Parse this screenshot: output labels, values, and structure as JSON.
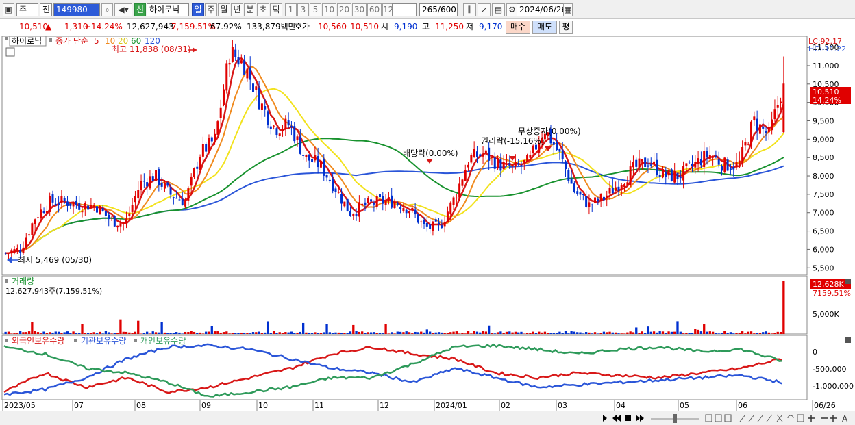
{
  "toolbar": {
    "period_main": "주",
    "prev_label": "전",
    "code": "149980",
    "badge": "신",
    "name": "하이로닉",
    "periods": [
      "일",
      "주",
      "월",
      "년",
      "분",
      "초",
      "틱"
    ],
    "intervals": [
      "1",
      "3",
      "5",
      "10",
      "20",
      "30",
      "60",
      "120"
    ],
    "count": "265",
    "count_total": "/600",
    "date": "2024/06/26"
  },
  "quote": {
    "price": "10,510",
    "arrow": "▲",
    "change": "1,310",
    "change_pct": "+14.24%",
    "volume": "12,627,943",
    "volume_pct": "7,159.51%",
    "turnover": "67.92%",
    "amount": "133,879백만",
    "ask_label": "호가",
    "ask": "10,560",
    "bid": "10,510",
    "open_label": "시",
    "open": "9,190",
    "high_label": "고",
    "high": "11,250",
    "low_label": "저",
    "low": "9,170",
    "buy_btn": "매수",
    "sell_btn": "매도",
    "eval_btn": "평"
  },
  "legend": {
    "name": "하이로닉",
    "ma_label": "종가 단순",
    "ma": [
      "5",
      "10",
      "20",
      "60",
      "120"
    ],
    "ma_colors": [
      "#d81818",
      "#f08a1e",
      "#f2e21c",
      "#18922e",
      "#2a55d8"
    ],
    "lc": "LC:92.17",
    "hc": "HC:-11.22"
  },
  "annotations": {
    "high_note": "최고 11,838 (08/31)",
    "low_note": "최저 5,469 (05/30)",
    "dividend": "배당락(0.00%)",
    "rights": "권리락(-15.16%)",
    "bonus": "무상증자(0.00%)"
  },
  "price_axis": [
    "11,500",
    "11,000",
    "10,500",
    "10,000",
    "9,500",
    "9,000",
    "8,500",
    "8,000",
    "7,500",
    "7,000",
    "6,500",
    "6,000",
    "5,500"
  ],
  "last_price_tag": {
    "price": "10,510",
    "pct": "14.24%"
  },
  "volume_panel": {
    "title": "거래량",
    "value": "12,627,943주(7,159.51%)",
    "axis": "5,000K",
    "tag": "12,628K",
    "tag_pct": "7159.51%"
  },
  "holdings_panel": {
    "series": [
      "외국인보유수량",
      "기관보유수량",
      "개인보유수량"
    ],
    "colors": [
      "#d81818",
      "#2a55d8",
      "#2e9a5a"
    ],
    "axis": [
      "0",
      "-500,000",
      "-1,000,000"
    ]
  },
  "x_axis": [
    "2023/05",
    "07",
    "08",
    "09",
    "10",
    "11",
    "12",
    "2024/01",
    "02",
    "03",
    "04",
    "05",
    "06",
    "06/26"
  ],
  "chart_data": [
    {
      "type": "candlestick",
      "title": "하이로닉",
      "x_start": "2023/05",
      "x_end": "2024/06/26",
      "ylim": [
        5300,
        11800
      ],
      "key_points": [
        {
          "date": "2023/05/30",
          "low": 5469
        },
        {
          "date": "2023/08/31",
          "high": 11838
        },
        {
          "date": "2024/06/26",
          "open": 9190,
          "high": 11250,
          "low": 9170,
          "close": 10510
        }
      ],
      "close_approx": [
        5900,
        6000,
        6900,
        7300,
        7300,
        7200,
        7200,
        6800,
        6700,
        7800,
        8000,
        7500,
        7300,
        8600,
        9000,
        11400,
        11000,
        10000,
        9300,
        9400,
        8500,
        8300,
        7700,
        7000,
        7200,
        7300,
        7300,
        7100,
        6600,
        6600,
        7400,
        8500,
        8600,
        8300,
        8200,
        8400,
        9300,
        8600,
        7600,
        7200,
        7400,
        7800,
        8200,
        8400,
        8000,
        8000,
        8300,
        8600,
        8300,
        8300,
        9500,
        9100,
        10510
      ],
      "moving_averages": [
        "5",
        "10",
        "20",
        "60",
        "120"
      ]
    },
    {
      "type": "bar",
      "title": "거래량",
      "unit": "주",
      "last_value": 12627943
    },
    {
      "type": "line",
      "series": [
        {
          "name": "외국인보유수량",
          "values": [
            -1000000,
            -600000,
            -900000,
            -700000,
            -1000000,
            -900000,
            -700000,
            -500000,
            -200000,
            -50000,
            -200000,
            -300000,
            -600000,
            -700000,
            -600000,
            -650000,
            -700000,
            -600000,
            -500000,
            -300000
          ]
        },
        {
          "name": "기관보유수량",
          "values": [
            -1050000,
            -950000,
            -700000,
            -300000,
            -50000,
            -20000,
            -100000,
            -300000,
            -500000,
            -600000,
            -800000,
            -500000,
            -700000,
            -900000,
            -850000,
            -800000,
            -750000,
            -700000,
            -650000,
            -800000
          ]
        },
        {
          "name": "개인보유수량",
          "values": [
            -50000,
            -200000,
            -500000,
            -600000,
            -800000,
            -1100000,
            -1000000,
            -900000,
            -700000,
            -700000,
            -400000,
            -50000,
            -20000,
            -100000,
            -200000,
            -100000,
            -50000,
            -150000,
            -100000,
            -350000
          ]
        }
      ],
      "ylim": [
        -1150000,
        150000
      ]
    }
  ]
}
